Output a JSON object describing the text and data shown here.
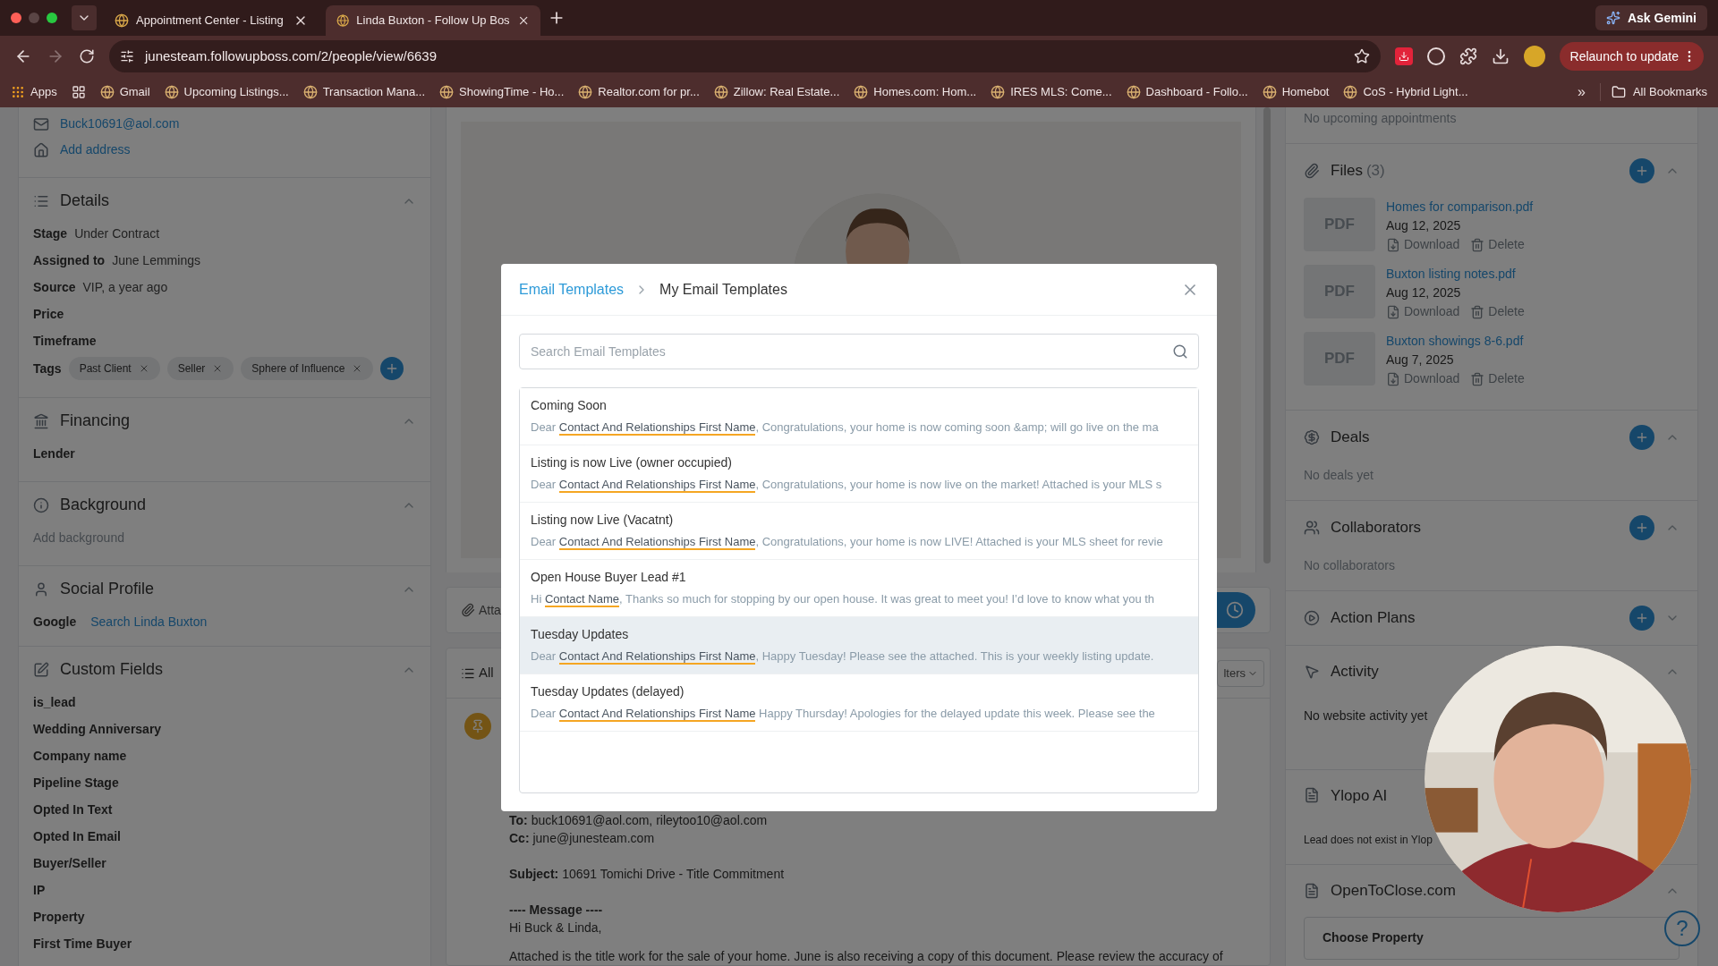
{
  "browser": {
    "tabs": [
      {
        "title": "Appointment Center - Listing",
        "selected": false
      },
      {
        "title": "Linda Buxton - Follow Up Bos",
        "selected": true
      }
    ],
    "ask_button": "Ask Gemini",
    "url": "junesteam.followupboss.com/2/people/view/6639",
    "relaunch_button": "Relaunch to update",
    "bookmarks": [
      "Apps",
      "Gmail",
      "Upcoming Listings...",
      "Transaction Mana...",
      "ShowingTime - Ho...",
      "Realtor.com for pr...",
      "Zillow: Real Estate...",
      "Homes.com: Hom...",
      "IRES MLS: Come...",
      "Dashboard - Follo...",
      "Homebot",
      "CoS - Hybrid Light..."
    ],
    "more_bookmarks": "»",
    "all_bookmarks": "All Bookmarks"
  },
  "contact_panel": {
    "email": "Buck10691@aol.com",
    "add_address": "Add address",
    "details": {
      "title": "Details",
      "expanded": true,
      "fields": [
        {
          "label": "Stage",
          "value": "Under Contract"
        },
        {
          "label": "Assigned to",
          "value": "June Lemmings"
        },
        {
          "label": "Source",
          "value": "VIP, a year ago"
        },
        {
          "label": "Price"
        },
        {
          "label": "Timeframe"
        }
      ],
      "tags_label": "Tags",
      "tags": [
        "Past Client",
        "Seller",
        "Sphere of Influence"
      ]
    },
    "financing": {
      "title": "Financing",
      "expanded": true,
      "fields": [
        "Lender"
      ]
    },
    "background": {
      "title": "Background",
      "expanded": true,
      "add_link": "Add background"
    },
    "social_profile": {
      "title": "Social Profile",
      "expanded": true,
      "label": "Google",
      "link": "Search Linda Buxton"
    },
    "custom_fields": {
      "title": "Custom Fields",
      "expanded": true,
      "fields": [
        "is_lead",
        "Wedding Anniversary",
        "Company name",
        "Pipeline Stage",
        "Opted In Text",
        "Opted In Email",
        "Buyer/Seller",
        "IP",
        "Property",
        "First Time Buyer"
      ]
    }
  },
  "timeline": {
    "attach_button": "Atta",
    "filter_label": "All",
    "filters_button": "lters",
    "email": {
      "to_label": "To:",
      "to": "buck10691@aol.com, rileytoo10@aol.com",
      "cc_label": "Cc:",
      "cc": "june@junesteam.com",
      "subject_label": "Subject:",
      "subject": "10691 Tomichi Drive - Title Commitment",
      "message_heading": "---- Message ----",
      "greeting": "Hi Buck & Linda,",
      "body": "Attached is the title work for the sale of your home. June is also receiving a copy of this document. Please review the accuracy of"
    }
  },
  "side_panel": {
    "appointments_note": "No upcoming appointments",
    "files": {
      "title": "Files",
      "count": "(3)",
      "expanded": true,
      "items": [
        {
          "thumb": "PDF",
          "name": "Homes for comparison.pdf",
          "date": "Aug 12, 2025",
          "download": "Download",
          "delete": "Delete"
        },
        {
          "thumb": "PDF",
          "name": "Buxton listing notes.pdf",
          "date": "Aug 12, 2025",
          "download": "Download",
          "delete": "Delete"
        },
        {
          "thumb": "PDF",
          "name": "Buxton showings 8-6.pdf",
          "date": "Aug 7, 2025",
          "download": "Download",
          "delete": "Delete"
        }
      ]
    },
    "deals": {
      "title": "Deals",
      "expanded": true,
      "note": "No deals yet"
    },
    "collaborators": {
      "title": "Collaborators",
      "expanded": true,
      "note": "No collaborators"
    },
    "action_plans": {
      "title": "Action Plans",
      "expanded": false
    },
    "activity": {
      "title": "Activity",
      "expanded": true,
      "note": "No website activity yet"
    },
    "ylopo": {
      "title": "Ylopo AI",
      "note": "Lead does not exist in Ylop"
    },
    "opentoclose": {
      "title": "OpenToClose.com",
      "expanded": true,
      "select": "Choose Property"
    },
    "help_button": "?"
  },
  "modal": {
    "breadcrumb_link": "Email Templates",
    "breadcrumb_current": "My Email Templates",
    "search": {
      "placeholder": "Search Email Templates"
    },
    "templates": [
      {
        "title": "Coming Soon",
        "greeting": "Dear",
        "merge_field": "Contact And Relationships First Name",
        "text": ", Congratulations, your home is now coming soon &amp; will go live on the ma",
        "highlighted": false
      },
      {
        "title": "Listing is now Live (owner occupied)",
        "greeting": "Dear",
        "merge_field": "Contact And Relationships First Name",
        "text": ", Congratulations, your home is now live on the market! Attached is your MLS s",
        "highlighted": false
      },
      {
        "title": "Listing now Live (Vacatnt)",
        "greeting": "Dear",
        "merge_field": "Contact And Relationships First Name",
        "text": ", Congratulations, your home is now LIVE! Attached is your MLS sheet for revie",
        "highlighted": false
      },
      {
        "title": "Open House Buyer Lead #1",
        "greeting": "Hi",
        "merge_field": "Contact Name",
        "text": ", Thanks so much for stopping by our open house. It was great to meet you! I’d love to know what you th",
        "highlighted": false
      },
      {
        "title": "Tuesday Updates",
        "greeting": "Dear",
        "merge_field": "Contact And Relationships First Name",
        "text": ", Happy Tuesday! Please see the attached. This is your weekly listing update.",
        "highlighted": true
      },
      {
        "title": "Tuesday Updates (delayed)",
        "greeting": "Dear",
        "merge_field": "Contact And Relationships First Name",
        "text": " Happy Thursday! Apologies for the delayed update this week. Please see the",
        "highlighted": false
      }
    ]
  }
}
